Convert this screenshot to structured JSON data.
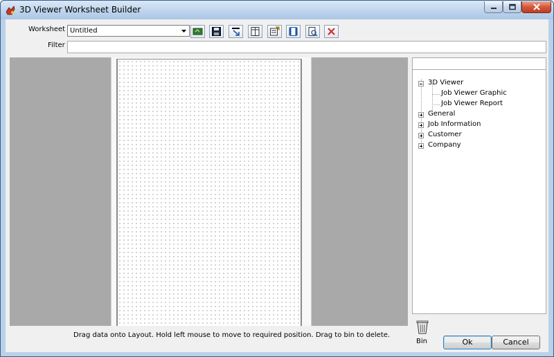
{
  "window": {
    "title": "3D Viewer Worksheet Builder",
    "controls": [
      "minimize-icon",
      "maximize-icon",
      "close-icon"
    ]
  },
  "form": {
    "worksheet_label": "Worksheet",
    "worksheet_value": "Untitled",
    "filter_label": "Filter",
    "filter_value": ""
  },
  "toolbar": {
    "buttons": [
      "new-worksheet-icon",
      "save-icon",
      "import-icon",
      "columns-icon",
      "properties-icon",
      "page-layout-icon",
      "print-preview-icon",
      "delete-icon"
    ]
  },
  "tree": {
    "items": [
      {
        "label": "3D Viewer",
        "expanded": true,
        "children": [
          "Job Viewer Graphic",
          "Job Viewer Report"
        ]
      },
      {
        "label": "General",
        "expanded": false
      },
      {
        "label": "Job Information",
        "expanded": false
      },
      {
        "label": "Customer",
        "expanded": false
      },
      {
        "label": "Company",
        "expanded": false
      }
    ]
  },
  "status_text": "Drag data onto Layout. Hold left mouse to move to required position. Drag to bin to delete.",
  "bin_label": "Bin",
  "buttons": {
    "ok": "Ok",
    "cancel": "Cancel"
  },
  "colors": {
    "layout_background": "#a9a9a9",
    "title_bar": "#bcd3ec",
    "close_button": "#d4583c"
  }
}
